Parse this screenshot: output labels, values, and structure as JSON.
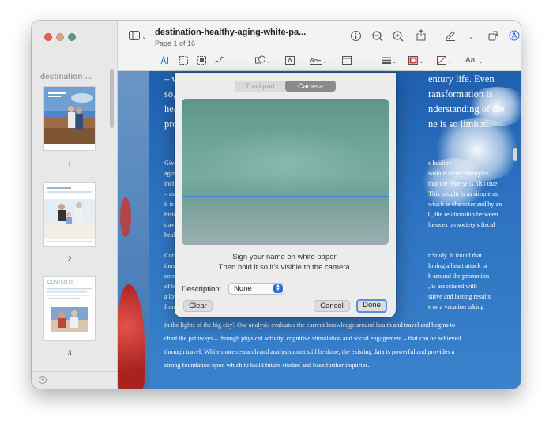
{
  "window": {
    "doc_title": "destination-healthy-aging-white-pa...",
    "page_info": "Page 1 of 16"
  },
  "sidebar": {
    "title": "destination-...",
    "pages": [
      "1",
      "2",
      "3"
    ],
    "thumb_contents_label": "CONTENTS"
  },
  "toolbar": {
    "icons": [
      "sidebar-icon",
      "info-icon",
      "zoom-out-icon",
      "zoom-in-icon",
      "share-icon",
      "markup-pen-icon",
      "rotate-icon",
      "markup-circle-icon",
      "search-icon",
      "text-select-icon",
      "rect-select-icon",
      "smart-lasso-icon",
      "sketch-icon",
      "shapes-icon",
      "textbox-icon",
      "sign-icon",
      "note-icon",
      "line-style-icon",
      "border-color-icon",
      "fill-color-icon",
      "font-icon"
    ],
    "font_label": "Aa"
  },
  "document": {
    "big_lines": [
      "– w                                                              entury life.  Even",
      "so,                                                             ransformation is",
      "hea                                                              nderstanding of the",
      "pro                                                              ne is so limited."
    ],
    "big_lines_left": [
      "– w",
      "so,",
      "hea",
      "pro"
    ],
    "big_lines_right": [
      "entury life.  Even",
      "ransformation is",
      "nderstanding of the",
      "ne is so limited."
    ],
    "small_left": [
      "Give",
      "agin",
      "inclu",
      "– as",
      "it is",
      "histo",
      "trave",
      "healt"
    ],
    "small_right": [
      "e healthy",
      "sustain active lifestyles,",
      "that the reverse is also true",
      "This insight is as simple as",
      "which is characterized by an",
      "0, the relationship between",
      "luences on society's fiscal"
    ],
    "para2_left": [
      "Corr",
      "thos",
      "coro",
      "of b",
      "a lov",
      "from"
    ],
    "para2_right": [
      "r Study. It found that",
      "loping a heart attack or",
      "h around the promotion",
      ", is associated with",
      "sitive and lasting results",
      "e or a vacation taking"
    ],
    "full_lines": [
      "in the lights of the big city?  Our analysis evaluates the current knowledge around health and travel and begins to",
      "chart the pathways – through physical activity, cognitive stimulation and social engagement – that can be achieved",
      "through travel.  While more research and analysis must still be done, the existing data is powerful and provides a",
      "strong foundation upon which to build future studies and base further inquiries."
    ]
  },
  "signature_sheet": {
    "tabs": [
      "Trackpad",
      "Camera"
    ],
    "selected_tab": "Camera",
    "instruction_line1": "Sign your name on white paper.",
    "instruction_line2": "Then hold it so it's visible to the camera.",
    "description_label": "Description:",
    "description_value": "None",
    "clear_label": "Clear",
    "cancel_label": "Cancel",
    "done_label": "Done",
    "accent_color": "#2f6fd4"
  }
}
